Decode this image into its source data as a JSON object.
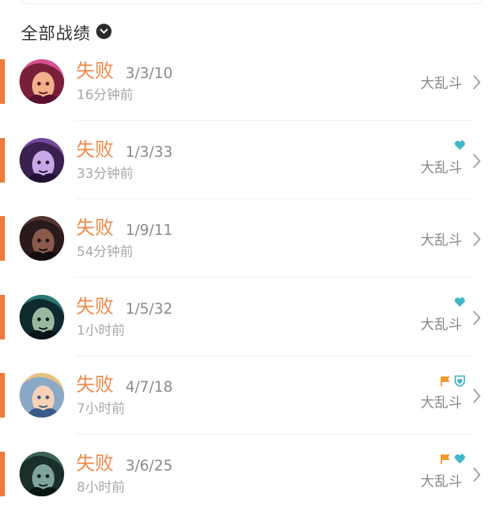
{
  "section": {
    "title": "全部战绩"
  },
  "colors": {
    "loss_accent": "#ee7a3c",
    "loss_text": "#ee8a4a",
    "heal_badge": "#3fb7c9",
    "flag_badge": "#f39a2c"
  },
  "matches": [
    {
      "result": "失败",
      "kda": "3/3/10",
      "time": "16分钟前",
      "mode": "大乱斗",
      "badges": [],
      "avatar": "champion-portrait-pink-hair"
    },
    {
      "result": "失败",
      "kda": "1/3/33",
      "time": "33分钟前",
      "mode": "大乱斗",
      "badges": [
        "heal-heart-icon"
      ],
      "avatar": "champion-portrait-purple-yordle"
    },
    {
      "result": "失败",
      "kda": "1/9/11",
      "time": "54分钟前",
      "mode": "大乱斗",
      "badges": [],
      "avatar": "champion-portrait-dark-rock"
    },
    {
      "result": "失败",
      "kda": "1/5/32",
      "time": "1小时前",
      "mode": "大乱斗",
      "badges": [
        "heal-heart-icon"
      ],
      "avatar": "champion-portrait-green-snake"
    },
    {
      "result": "失败",
      "kda": "4/7/18",
      "time": "7小时前",
      "mode": "大乱斗",
      "badges": [
        "flag-icon",
        "shield-icon"
      ],
      "avatar": "champion-portrait-blonde"
    },
    {
      "result": "失败",
      "kda": "3/6/25",
      "time": "8小时前",
      "mode": "大乱斗",
      "badges": [
        "flag-icon",
        "heal-heart-icon"
      ],
      "avatar": "champion-portrait-dark-green"
    }
  ]
}
